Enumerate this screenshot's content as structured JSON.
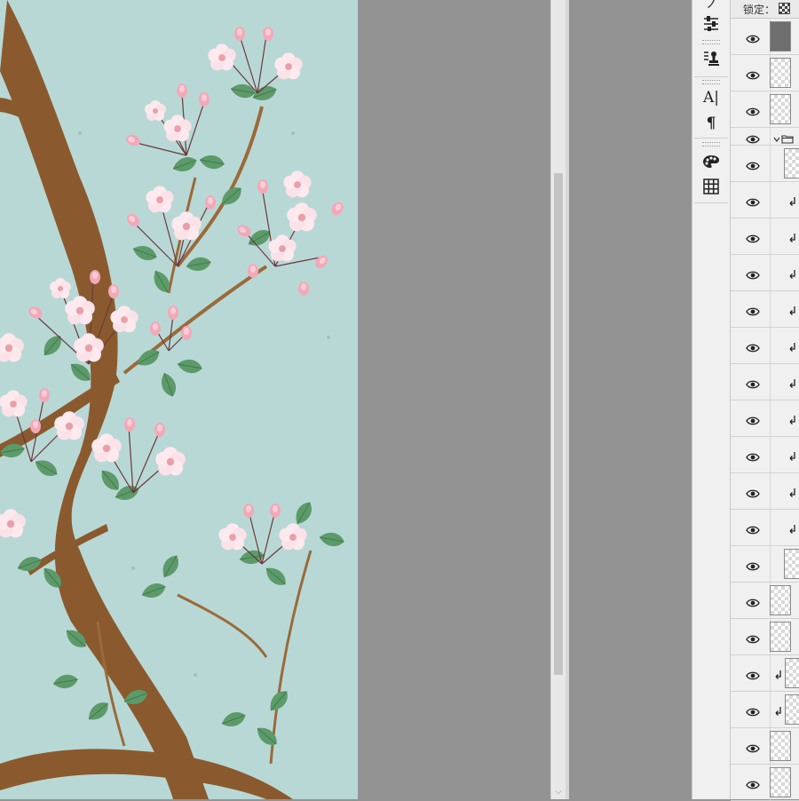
{
  "app": {
    "colors": {
      "canvas_bg": "#939393",
      "panel_bg": "#f0f0f0",
      "artwork_bg": "#b8d8d6"
    }
  },
  "artwork": {
    "subject": "cherry-blossom-branches",
    "flower_color": "#f3a8b8",
    "leaf_color": "#5d9a6a",
    "branch_color": "#8a5a2e"
  },
  "tools": [
    {
      "name": "brush-tool",
      "icon": "brush-icon"
    },
    {
      "name": "adjust-sliders",
      "icon": "sliders-icon"
    },
    {
      "name": "clone-source",
      "icon": "stamp-icon"
    },
    {
      "name": "character-panel",
      "icon": "character-icon",
      "glyph": "A|"
    },
    {
      "name": "paragraph-panel",
      "icon": "paragraph-icon",
      "glyph": "¶"
    },
    {
      "name": "swatches-panel",
      "icon": "palette-icon"
    },
    {
      "name": "grid-panel",
      "icon": "grid-icon"
    }
  ],
  "layers_panel": {
    "lock_label": "锁定：",
    "rows": [
      {
        "type": "layer",
        "thumb": "dark"
      },
      {
        "type": "layer",
        "thumb": "transparent"
      },
      {
        "type": "layer",
        "thumb": "transparent"
      },
      {
        "type": "group",
        "expanded": true
      },
      {
        "type": "layer",
        "thumb": "transparent",
        "indent": true
      },
      {
        "type": "clipped",
        "indent": true
      },
      {
        "type": "clipped",
        "indent": true
      },
      {
        "type": "clipped",
        "indent": true
      },
      {
        "type": "clipped",
        "indent": true
      },
      {
        "type": "clipped",
        "indent": true
      },
      {
        "type": "clipped",
        "indent": true
      },
      {
        "type": "clipped",
        "indent": true
      },
      {
        "type": "clipped",
        "indent": true
      },
      {
        "type": "clipped",
        "indent": true
      },
      {
        "type": "clipped",
        "indent": true
      },
      {
        "type": "layer",
        "thumb": "transparent",
        "indent": true
      },
      {
        "type": "layer",
        "thumb": "transparent"
      },
      {
        "type": "layer",
        "thumb": "transparent"
      },
      {
        "type": "clipped-thumb",
        "thumb": "transparent"
      },
      {
        "type": "clipped-thumb",
        "thumb": "transparent"
      },
      {
        "type": "layer",
        "thumb": "transparent"
      },
      {
        "type": "layer",
        "thumb": "transparent"
      }
    ]
  }
}
